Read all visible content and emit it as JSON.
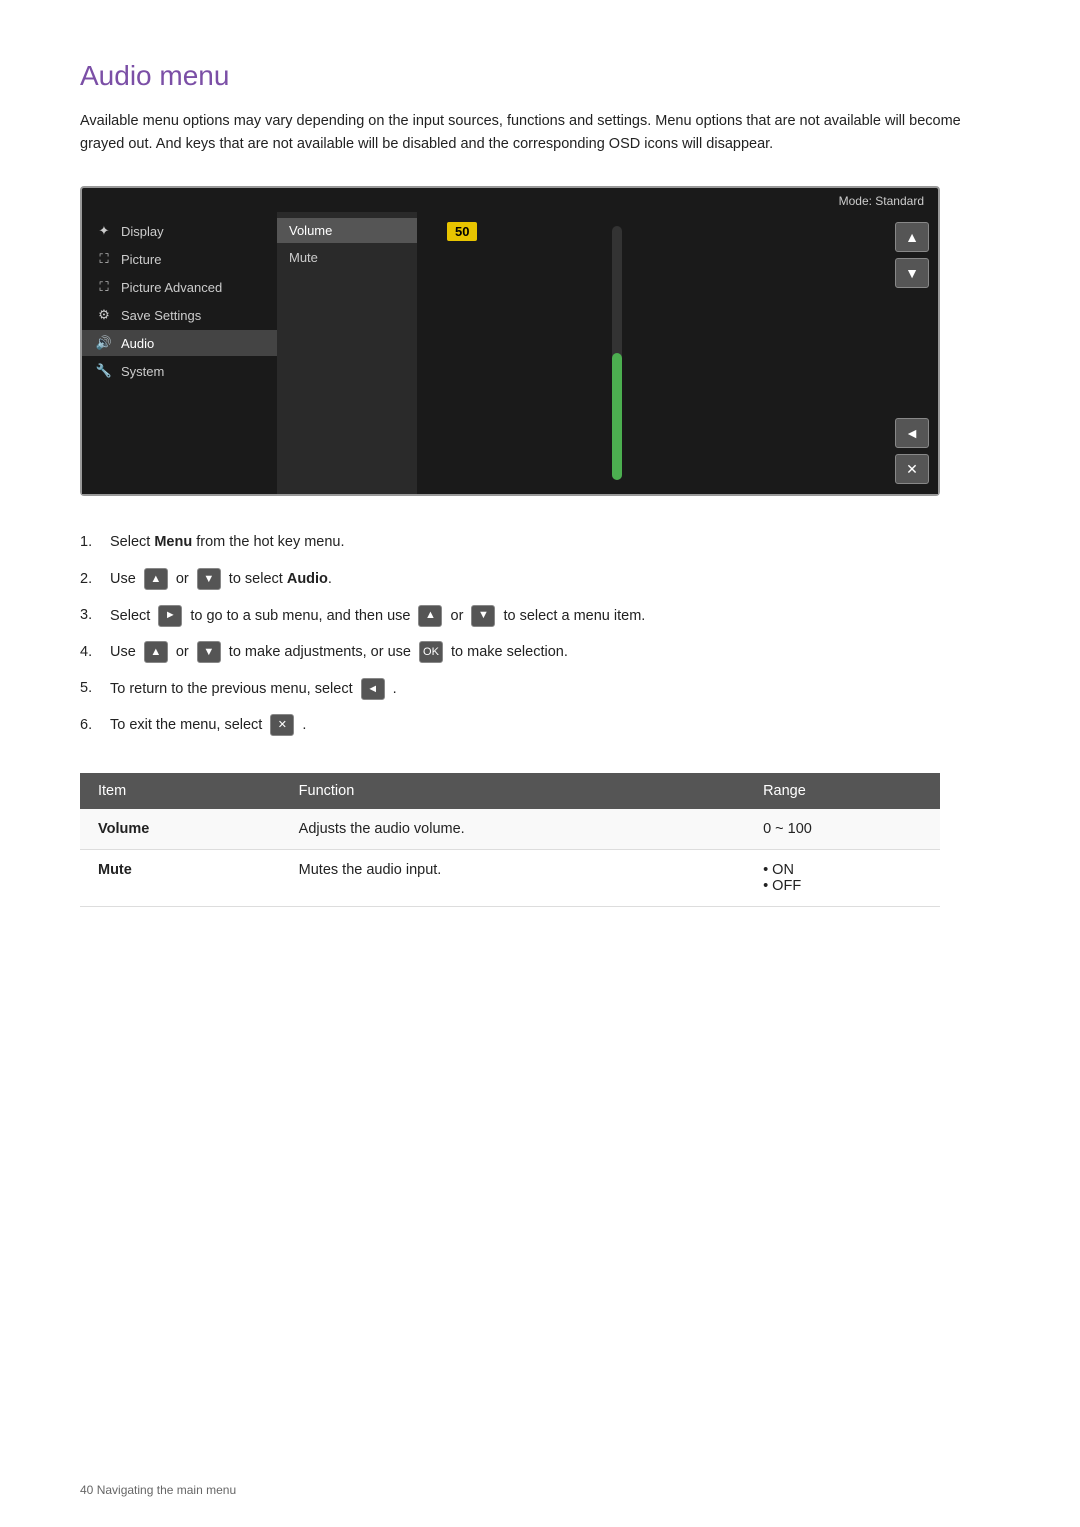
{
  "page": {
    "title": "Audio menu",
    "intro": "Available menu options may vary depending on the input sources, functions and settings. Menu options that are not available will become grayed out. And keys that are not available will be disabled and the corresponding OSD icons will disappear."
  },
  "osd": {
    "mode_label": "Mode: Standard",
    "menu_items": [
      {
        "label": "Display",
        "icon": "✦",
        "active": false
      },
      {
        "label": "Picture",
        "icon": "🖼",
        "active": false
      },
      {
        "label": "Picture Advanced",
        "icon": "🖼",
        "active": false
      },
      {
        "label": "Save Settings",
        "icon": "⚙",
        "active": false
      },
      {
        "label": "Audio",
        "icon": "🔊",
        "active": true
      },
      {
        "label": "System",
        "icon": "🔧",
        "active": false
      }
    ],
    "submenu_items": [
      {
        "label": "Volume",
        "highlighted": true
      },
      {
        "label": "Mute",
        "highlighted": false
      }
    ],
    "value": "50",
    "buttons": [
      "▲",
      "▼",
      "◄",
      "✕"
    ]
  },
  "instructions": [
    {
      "num": "1.",
      "text_before": "Select ",
      "bold": "Menu",
      "text_after": " from the hot key menu.",
      "has_buttons": false
    },
    {
      "num": "2.",
      "text_before": "Use",
      "text_middle": "or",
      "text_after": "to select ",
      "bold_after": "Audio",
      "has_up_down": true
    },
    {
      "num": "3.",
      "text_before": "Select",
      "text_middle": "to go to a sub menu, and then use",
      "text_or": "or",
      "text_after": "to select a menu item.",
      "has_right_btn": true,
      "has_down_btn": true
    },
    {
      "num": "4.",
      "text_before": "Use",
      "text_middle": "or",
      "text_after": "to make adjustments, or use",
      "text_final": "to make selection.",
      "has_up_down": true,
      "has_ok_btn": true
    },
    {
      "num": "5.",
      "text_before": "To return to the previous menu, select",
      "text_after": ".",
      "has_back_btn": true
    },
    {
      "num": "6.",
      "text_before": "To exit the menu, select",
      "text_after": ".",
      "has_exit_btn": true
    }
  ],
  "table": {
    "headers": [
      "Item",
      "Function",
      "Range"
    ],
    "rows": [
      {
        "item": "Volume",
        "function": "Adjusts the audio volume.",
        "range": "0 ~ 100"
      },
      {
        "item": "Mute",
        "function": "Mutes the audio input.",
        "range": "• ON\n• OFF"
      }
    ]
  },
  "footer": {
    "page_num": "40",
    "section": "Navigating the main menu"
  }
}
